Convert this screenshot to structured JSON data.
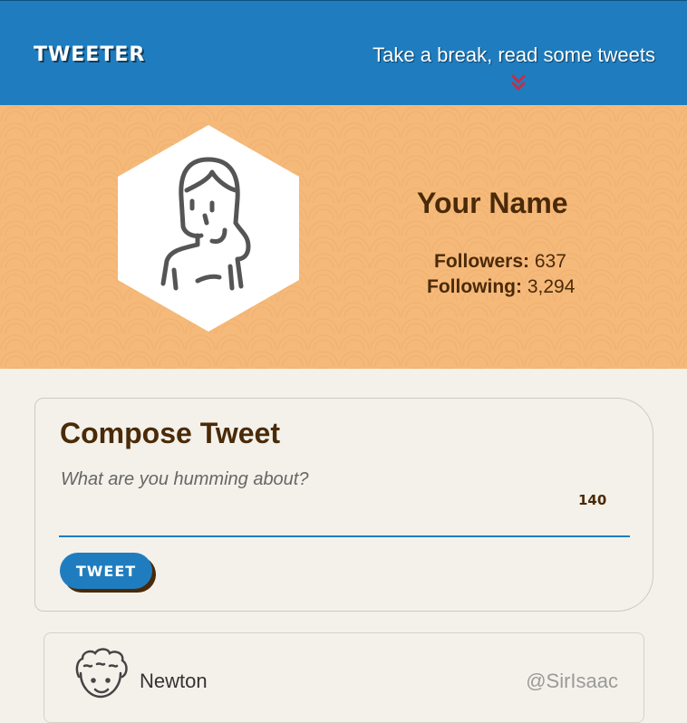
{
  "nav": {
    "brand": "TWEETER",
    "tagline": "Take a break, read some tweets",
    "icons": {
      "scroll": "double-chevron-down-icon"
    }
  },
  "profile": {
    "name": "Your Name",
    "followers_label": "Followers:",
    "followers_value": "637",
    "following_label": "Following:",
    "following_value": "3,294",
    "avatar_icon": "user-avatar-icon"
  },
  "compose": {
    "title": "Compose Tweet",
    "placeholder": "What are you humming about?",
    "counter": "140",
    "submit_label": "TWEET"
  },
  "tweets": [
    {
      "author": "Newton",
      "handle": "@SirIsaac",
      "avatar_icon": "curly-hair-avatar-icon"
    }
  ],
  "colors": {
    "nav_bg": "#1f7dbf",
    "profile_bg": "#f5b97a",
    "page_bg": "#f4f1ea",
    "text_brown": "#4a2a08",
    "chevron": "#c0304a"
  }
}
